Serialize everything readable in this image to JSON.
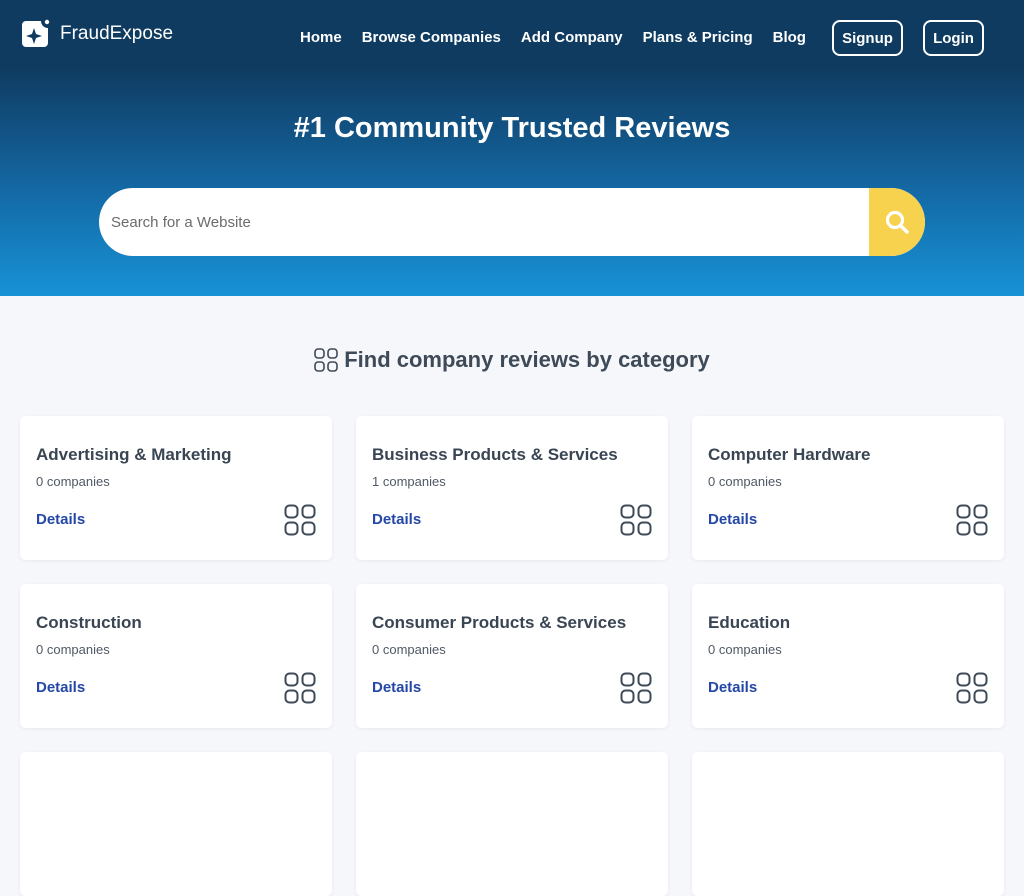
{
  "brand": {
    "name": "FraudExpose",
    "logo_icon": "brand-logo-icon"
  },
  "nav": {
    "links": [
      "Home",
      "Browse Companies",
      "Add Company",
      "Plans & Pricing",
      "Blog"
    ],
    "signup": "Signup",
    "login": "Login"
  },
  "hero": {
    "title": "#1 Community Trusted Reviews",
    "search_placeholder": "Search for a Website",
    "search_icon": "search-icon"
  },
  "categories": {
    "heading": "Find company reviews by category",
    "heading_icon": "grid-icon",
    "details_label": "Details",
    "items": [
      {
        "title": "Advertising & Marketing",
        "count": "0 companies"
      },
      {
        "title": "Business Products & Services",
        "count": "1 companies"
      },
      {
        "title": "Computer Hardware",
        "count": "0 companies"
      },
      {
        "title": "Construction",
        "count": "0 companies"
      },
      {
        "title": "Consumer Products & Services",
        "count": "0 companies"
      },
      {
        "title": "Education",
        "count": "0 companies"
      }
    ]
  },
  "colors": {
    "nav_bg": "#0f3b61",
    "hero_gradient_end": "#1792d6",
    "search_button": "#f7d24f",
    "link_blue": "#2447a8",
    "page_bg": "#f5f7fa"
  }
}
